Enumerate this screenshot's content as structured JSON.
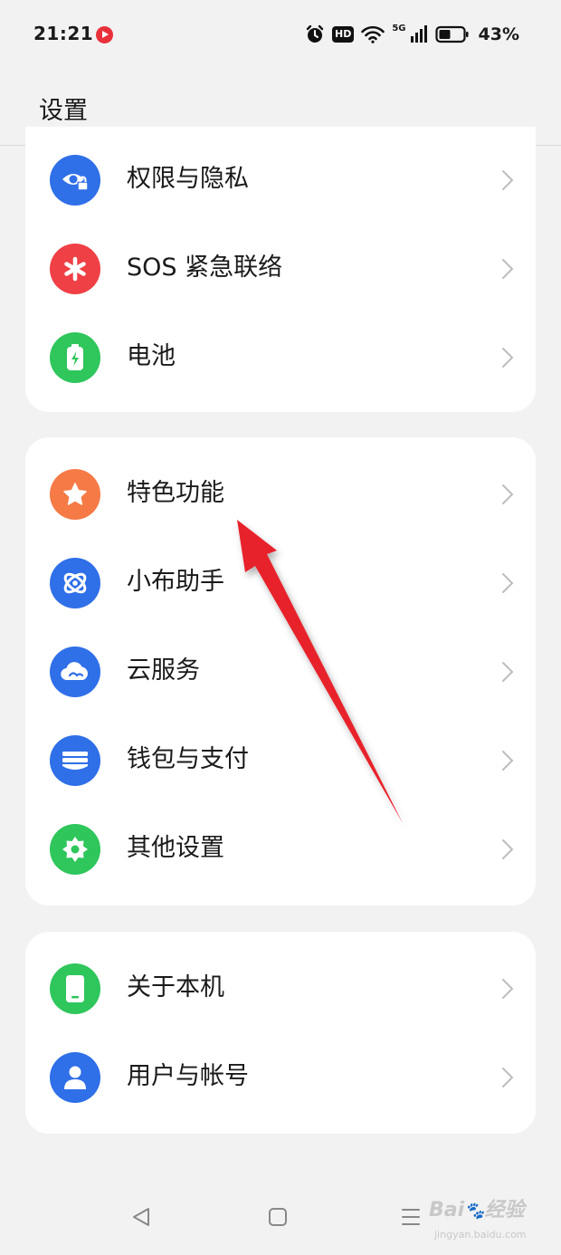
{
  "status_bar": {
    "time": "21:21",
    "hd": "HD",
    "network": "5G",
    "battery": "43%"
  },
  "header": {
    "title": "设置"
  },
  "groups": [
    {
      "items": [
        {
          "label": "权限与隐私",
          "icon": "privacy-eye-lock-icon",
          "color": "#2f6fe8"
        },
        {
          "label": "SOS 紧急联络",
          "icon": "sos-asterisk-icon",
          "color": "#ee4045"
        },
        {
          "label": "电池",
          "icon": "battery-icon",
          "color": "#2fc65c"
        }
      ]
    },
    {
      "items": [
        {
          "label": "特色功能",
          "icon": "star-icon",
          "color": "#f57a46"
        },
        {
          "label": "小布助手",
          "icon": "assistant-orbit-icon",
          "color": "#2f6fe8"
        },
        {
          "label": "云服务",
          "icon": "cloud-icon",
          "color": "#2f6fe8"
        },
        {
          "label": "钱包与支付",
          "icon": "wallet-icon",
          "color": "#2f6fe8"
        },
        {
          "label": "其他设置",
          "icon": "gear-icon",
          "color": "#2fc65c"
        }
      ]
    },
    {
      "items": [
        {
          "label": "关于本机",
          "icon": "phone-icon",
          "color": "#2fc65c"
        },
        {
          "label": "用户与帐号",
          "icon": "user-icon",
          "color": "#2f6fe8"
        }
      ]
    }
  ],
  "nav": {
    "back": "back-icon",
    "home": "home-icon",
    "recents": "menu-icon"
  },
  "watermark": {
    "brand": "Bai",
    "brand2": "经验",
    "url": "jingyan.baidu.com"
  },
  "annotation": {
    "arrow_color": "#e8202a"
  }
}
